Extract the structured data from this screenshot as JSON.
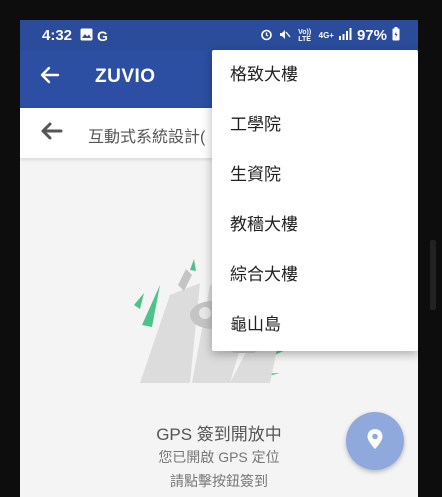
{
  "status_bar": {
    "time": "4:32",
    "battery_percent": "97%",
    "lte_label": "Vo)) LTE",
    "network_label": "4G+"
  },
  "app_bar": {
    "title": "ZUVIO"
  },
  "sub_header": {
    "course_name": "互動式系統設計("
  },
  "gps": {
    "title": "GPS 簽到開放中",
    "line1": "您已開啟 GPS 定位",
    "line2": "請點擊按鈕簽到"
  },
  "menu": {
    "items": [
      {
        "label": "格致大樓"
      },
      {
        "label": "工學院"
      },
      {
        "label": "生資院"
      },
      {
        "label": "教穡大樓"
      },
      {
        "label": "綜合大樓"
      },
      {
        "label": "龜山島"
      }
    ]
  },
  "colors": {
    "status_bar": "#2b4c9a",
    "app_bar": "#2c4fa3",
    "fab": "#8fa9dc",
    "illustration_accent": "#4cc38a"
  }
}
